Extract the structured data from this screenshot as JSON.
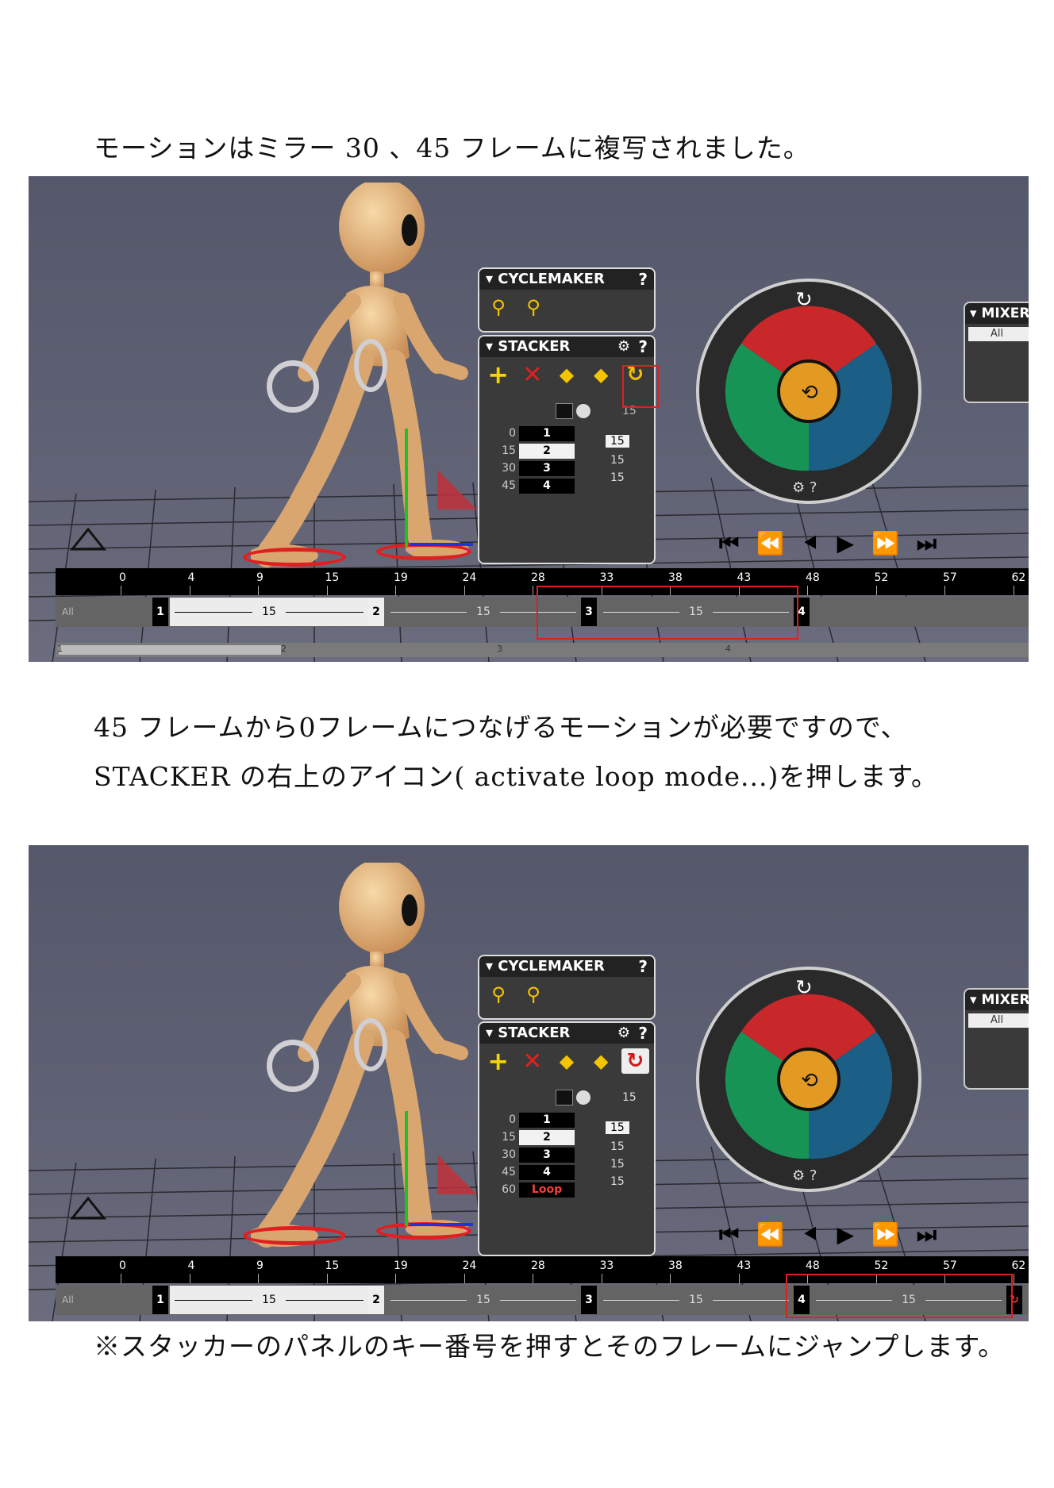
{
  "captions": {
    "c1": "モーションはミラー 30 、45 フレームに複写されました。",
    "c2a": "45 フレームから0フレームにつなげるモーションが必要ですので、",
    "c2b": "STACKER の右上のアイコン( activate loop mode...)を押します。",
    "c3": "※スタッカーのパネルのキー番号を押すとそのフレームにジャンプします。"
  },
  "ui": {
    "cyclemaker_title": "▾ CYCLEMAKER",
    "stacker_title": "▾ STACKER",
    "help": "?",
    "gear": "⚙",
    "mixer_title": "▾ MIXER",
    "mixer_all": "All",
    "track_label": "All",
    "stacker_duration": "15",
    "loop_label": "Loop"
  },
  "shot1": {
    "keys": [
      {
        "frame": "0",
        "num": "1",
        "dur": ""
      },
      {
        "frame": "15",
        "num": "2",
        "dur": "15"
      },
      {
        "frame": "30",
        "num": "3",
        "dur": "15"
      },
      {
        "frame": "45",
        "num": "4",
        "dur": "15"
      }
    ],
    "timeline_ticks": [
      "0",
      "4",
      "9",
      "15",
      "19",
      "24",
      "28",
      "33",
      "38",
      "43",
      "48",
      "52",
      "57",
      "62"
    ],
    "segments": [
      "15",
      "15",
      "15"
    ],
    "scroll_nums": [
      "1",
      "2",
      "3",
      "4"
    ]
  },
  "shot2": {
    "keys": [
      {
        "frame": "0",
        "num": "1",
        "dur": "15"
      },
      {
        "frame": "15",
        "num": "2",
        "dur": "15"
      },
      {
        "frame": "30",
        "num": "3",
        "dur": "15"
      },
      {
        "frame": "45",
        "num": "4",
        "dur": "15"
      },
      {
        "frame": "60",
        "num": "Loop",
        "dur": ""
      }
    ],
    "timeline_ticks": [
      "0",
      "4",
      "9",
      "15",
      "19",
      "24",
      "28",
      "33",
      "38",
      "43",
      "48",
      "52",
      "57",
      "62"
    ],
    "segments": [
      "15",
      "15",
      "15",
      "15"
    ]
  }
}
